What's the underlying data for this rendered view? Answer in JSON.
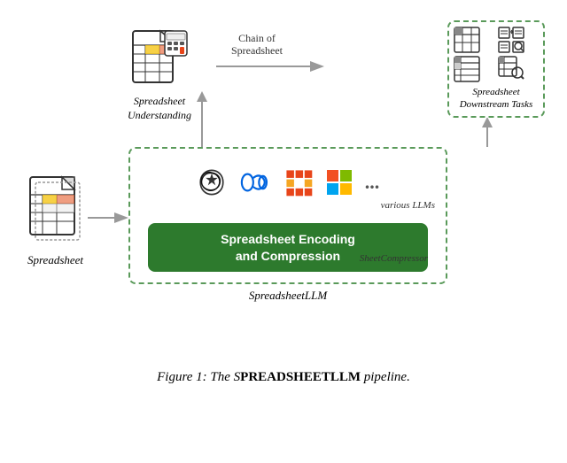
{
  "diagram": {
    "spreadsheet_label": "Spreadsheet",
    "chain_label": "Chain of\nSpreadsheet",
    "understanding_label": "Spreadsheet\nUnderstanding",
    "downstream_label": "Spreadsheet\nDownstream Tasks",
    "various_llms_label": "various LLMs",
    "encoding_line1": "Spreadsheet Encoding",
    "encoding_line2": "and Compression",
    "sheetcompressor_label": "SheetCompressor",
    "spreadsheetllm_label": "SpreadsheetLLM",
    "dots": "..."
  },
  "caption": {
    "text": "Figure 1: The S",
    "smallcaps": "PREADSHEETLLM",
    "text2": " pipeline."
  }
}
